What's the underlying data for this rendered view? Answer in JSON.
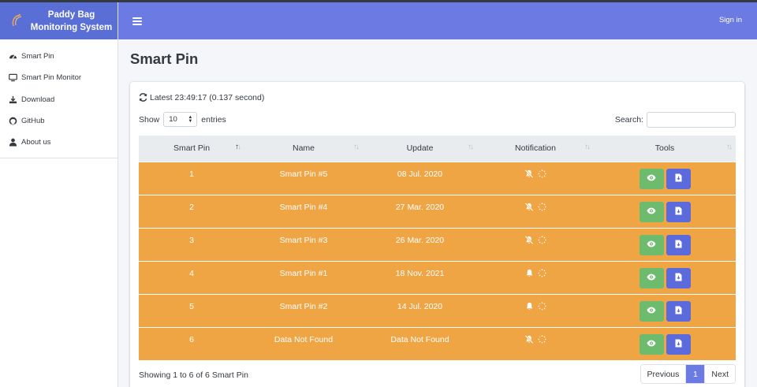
{
  "brand": {
    "line1": "Paddy Bag",
    "line2": "Monitoring System"
  },
  "sidebar": {
    "items": [
      {
        "label": "Smart Pin",
        "icon": "dashboard-icon"
      },
      {
        "label": "Smart Pin Monitor",
        "icon": "monitor-icon"
      },
      {
        "label": "Download",
        "icon": "download-icon"
      },
      {
        "label": "GitHub",
        "icon": "github-icon"
      },
      {
        "label": "About us",
        "icon": "user-icon"
      }
    ]
  },
  "header": {
    "signin": "Sign in"
  },
  "page": {
    "title": "Smart Pin"
  },
  "card": {
    "latest": "Latest 23:49:17 (0.137 second)",
    "show_label": "Show",
    "show_value": "10",
    "entries_label": "entries",
    "search_label": "Search:",
    "search_value": "",
    "columns": [
      "Smart Pin",
      "Name",
      "Update",
      "Notification",
      "Tools"
    ],
    "rows": [
      {
        "pin": "1",
        "name": "Smart Pin #5",
        "update": "08 Jul. 2020",
        "notification": "bell-slash-icon"
      },
      {
        "pin": "2",
        "name": "Smart Pin #4",
        "update": "27 Mar. 2020",
        "notification": "bell-slash-icon"
      },
      {
        "pin": "3",
        "name": "Smart Pin #3",
        "update": "26 Mar. 2020",
        "notification": "bell-slash-icon"
      },
      {
        "pin": "4",
        "name": "Smart Pin #1",
        "update": "18 Nov. 2021",
        "notification": "bell-icon"
      },
      {
        "pin": "5",
        "name": "Smart Pin #2",
        "update": "14 Jul. 2020",
        "notification": "bell-icon"
      },
      {
        "pin": "6",
        "name": "Data Not Found",
        "update": "Data Not Found",
        "notification": "bell-slash-icon"
      }
    ],
    "info": "Showing 1 to 6 of 6 Smart Pin",
    "pagination": {
      "previous": "Previous",
      "current": "1",
      "next": "Next"
    }
  },
  "colors": {
    "header": "#6c7be4",
    "brand": "#5a6fd6",
    "row": "#f0a545",
    "view_button": "#6dbb6d",
    "download_button": "#5c6bdc"
  }
}
